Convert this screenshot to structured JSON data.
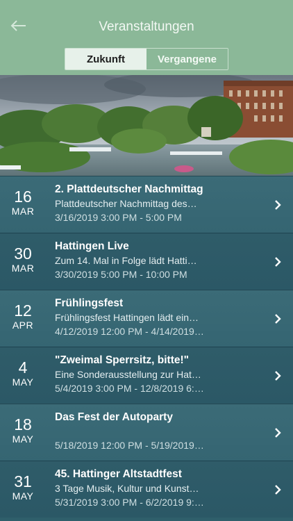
{
  "header": {
    "title": "Veranstaltungen",
    "back_icon": "arrow-left-icon"
  },
  "tabs": [
    {
      "label": "Zukunft",
      "active": true
    },
    {
      "label": "Vergangene",
      "active": false
    }
  ],
  "events": [
    {
      "day": "16",
      "month": "MAR",
      "title": "2. Plattdeutscher Nachmittag",
      "description": "Plattdeutscher Nachmittag des…",
      "time": "3/16/2019 3:00 PM - 5:00 PM"
    },
    {
      "day": "30",
      "month": "MAR",
      "title": "Hattingen Live",
      "description": "Zum 14. Mal in Folge lädt Hatti…",
      "time": "3/30/2019 5:00 PM - 10:00 PM"
    },
    {
      "day": "12",
      "month": "APR",
      "title": "Frühlingsfest",
      "description": "Frühlingsfest Hattingen lädt ein…",
      "time": "4/12/2019 12:00 PM - 4/14/2019…"
    },
    {
      "day": "4",
      "month": "MAY",
      "title": "\"Zweimal Sperrsitz, bitte!\"",
      "description": "Eine Sonderausstellung zur Hat…",
      "time": "5/4/2019 3:00 PM - 12/8/2019 6:…"
    },
    {
      "day": "18",
      "month": "MAY",
      "title": "Das Fest der Autoparty",
      "description": "",
      "time": "5/18/2019 12:00 PM - 5/19/2019…"
    },
    {
      "day": "31",
      "month": "MAY",
      "title": "45. Hattinger Altstadtfest",
      "description": "3 Tage Musik, Kultur und Kunst…",
      "time": "5/31/2019 3:00 PM - 6/2/2019 9:…"
    }
  ],
  "colors": {
    "header": "#8bb898",
    "list": "#356572"
  }
}
